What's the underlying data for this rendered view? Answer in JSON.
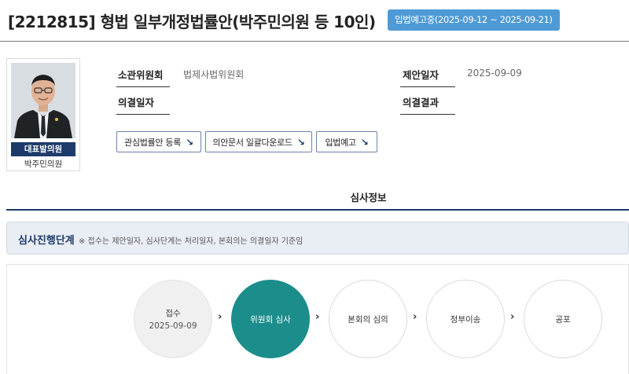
{
  "bill": {
    "title": "[2212815] 형법 일부개정법률안(박주민의원 등 10인)",
    "status": "입법예고중(2025-09-12 ~ 2025-09-21)"
  },
  "sponsor": {
    "role": "대표발의원",
    "name": "박주민의원"
  },
  "info": {
    "committee_label": "소관위원회",
    "committee_value": "법제사법위원회",
    "proposal_date_label": "제안일자",
    "proposal_date_value": "2025-09-09",
    "decision_date_label": "의결일자",
    "decision_date_value": "",
    "decision_result_label": "의결결과",
    "decision_result_value": ""
  },
  "actions": {
    "interest_label": "관심법률안 등록",
    "download_label": "의안문서 일괄다운로드",
    "notice_label": "입법예고",
    "arrow": "↘"
  },
  "tab": {
    "title": "심사정보"
  },
  "progress": {
    "heading": "심사진행단계",
    "note": "※ 접수는 제안일자, 심사단계는 처리일자, 본회의는 의결일자 기준임",
    "arrow": "›",
    "stages": [
      {
        "label": "접수",
        "date": "2025-09-09",
        "state": "done"
      },
      {
        "label": "위원회 심사",
        "date": "",
        "state": "active"
      },
      {
        "label": "본회의 심의",
        "date": "",
        "state": "pending"
      },
      {
        "label": "정부이송",
        "date": "",
        "state": "pending"
      },
      {
        "label": "공포",
        "date": "",
        "state": "pending"
      }
    ]
  },
  "colors": {
    "navy": "#1d3a6b",
    "badge_blue": "#4e9ad6",
    "active_teal": "#1b8e8b",
    "banner_bg": "#e9edf4"
  }
}
